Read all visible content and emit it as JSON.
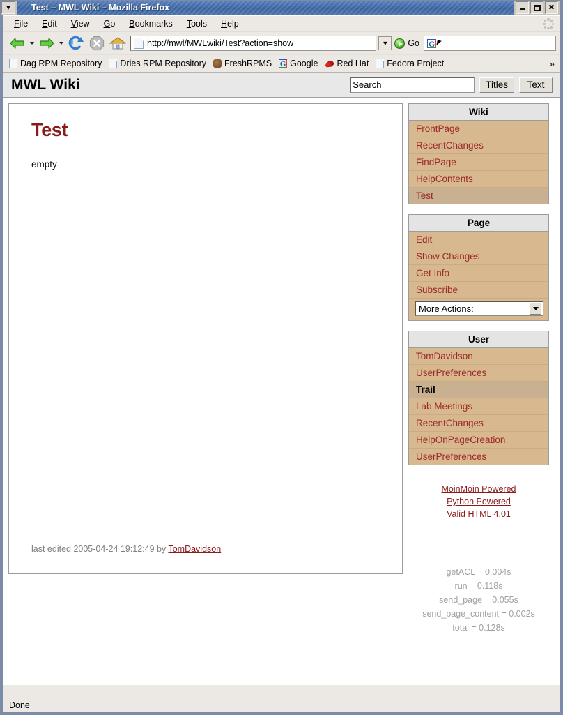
{
  "window": {
    "title": "Test – MWL Wiki – Mozilla Firefox",
    "menu_button_icon": "chevron-down-icon",
    "minimize_label": "",
    "maximize_label": "",
    "close_label": "✖"
  },
  "menubar": {
    "items": [
      {
        "label": "File",
        "accel": "F"
      },
      {
        "label": "Edit",
        "accel": "E"
      },
      {
        "label": "View",
        "accel": "V"
      },
      {
        "label": "Go",
        "accel": "G"
      },
      {
        "label": "Bookmarks",
        "accel": "B"
      },
      {
        "label": "Tools",
        "accel": "T"
      },
      {
        "label": "Help",
        "accel": "H"
      }
    ]
  },
  "toolbar": {
    "back_icon": "back-arrow-icon",
    "forward_icon": "forward-arrow-icon",
    "reload_icon": "reload-icon",
    "stop_icon": "stop-icon",
    "home_icon": "home-icon",
    "url": "http://mwl/MWLwiki/Test?action=show",
    "go_label": "Go",
    "search_value": "",
    "search_placeholder": "",
    "search_engine_icon": "google-icon"
  },
  "bookmarks": {
    "items": [
      {
        "label": "Dag RPM Repository",
        "icon": "document-icon"
      },
      {
        "label": "Dries RPM Repository",
        "icon": "document-icon"
      },
      {
        "label": "FreshRPMS",
        "icon": "freshrpms-icon"
      },
      {
        "label": "Google",
        "icon": "google-icon"
      },
      {
        "label": "Red Hat",
        "icon": "redhat-icon"
      },
      {
        "label": "Fedora Project",
        "icon": "document-icon"
      }
    ],
    "overflow_label": "»"
  },
  "wiki": {
    "logo": "MWL Wiki",
    "search_value": "Search",
    "search_placeholder": "Search",
    "titles_button": "Titles",
    "text_button": "Text"
  },
  "page": {
    "title": "Test",
    "body": "empty",
    "last_edited_prefix": "last edited 2005-04-24 19:12:49 by ",
    "last_edited_author": "TomDavidson"
  },
  "sidebar": {
    "boxes": [
      {
        "title": "Wiki",
        "items": [
          {
            "label": "FrontPage",
            "state": "link"
          },
          {
            "label": "RecentChanges",
            "state": "link"
          },
          {
            "label": "FindPage",
            "state": "link"
          },
          {
            "label": "HelpContents",
            "state": "link"
          },
          {
            "label": "Test",
            "state": "current"
          }
        ]
      },
      {
        "title": "Page",
        "items": [
          {
            "label": "Edit",
            "state": "link"
          },
          {
            "label": "Show Changes",
            "state": "link"
          },
          {
            "label": "Get Info",
            "state": "link"
          },
          {
            "label": "Subscribe",
            "state": "link"
          }
        ],
        "select": {
          "value": "More Actions:",
          "icon": "chevron-down-icon"
        }
      },
      {
        "title": "User",
        "items": [
          {
            "label": "TomDavidson",
            "state": "link"
          },
          {
            "label": "UserPreferences",
            "state": "link"
          },
          {
            "label": "Trail",
            "state": "subheader"
          },
          {
            "label": "Lab Meetings",
            "state": "link"
          },
          {
            "label": "RecentChanges",
            "state": "link"
          },
          {
            "label": "HelpOnPageCreation",
            "state": "link"
          },
          {
            "label": "UserPreferences",
            "state": "link"
          }
        ]
      }
    ],
    "credits": [
      "MoinMoin Powered",
      "Python Powered",
      "Valid HTML 4.01"
    ],
    "timings": [
      "getACL = 0.004s",
      "run = 0.118s",
      "send_page = 0.055s",
      "send_page_content = 0.002s",
      "total = 0.128s"
    ]
  },
  "statusbar": {
    "text": "Done"
  },
  "colors": {
    "titlebar_blue": "#39639f",
    "wiki_link_red": "#9d2a2a",
    "page_title_red": "#8b1a1a",
    "sidebar_tan": "#d8b88f",
    "sidebar_current_tan": "#c8b090",
    "chrome_gray": "#ece9e4"
  }
}
